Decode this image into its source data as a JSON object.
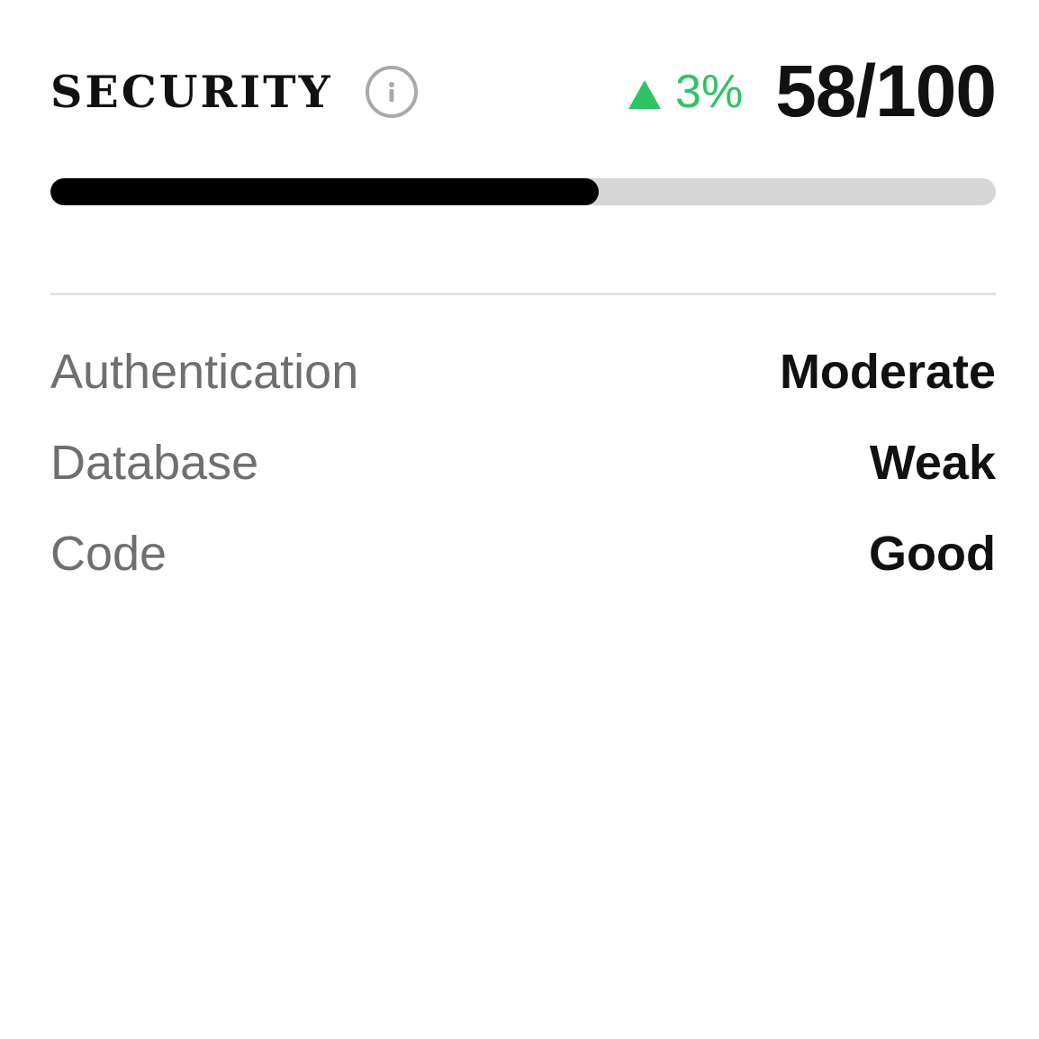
{
  "card": {
    "title": "SECURITY",
    "info_icon": "info-icon",
    "change": {
      "direction": "up",
      "icon": "triangle-up-icon",
      "text": "3%",
      "color": "#2ec463"
    },
    "score_text": "58/100",
    "progress_percent": 58,
    "progress_color": "#000000",
    "track_color": "#d6d6d6",
    "metrics": [
      {
        "label": "Authentication",
        "value": "Moderate"
      },
      {
        "label": "Database",
        "value": "Weak"
      },
      {
        "label": "Code",
        "value": "Good"
      }
    ]
  }
}
